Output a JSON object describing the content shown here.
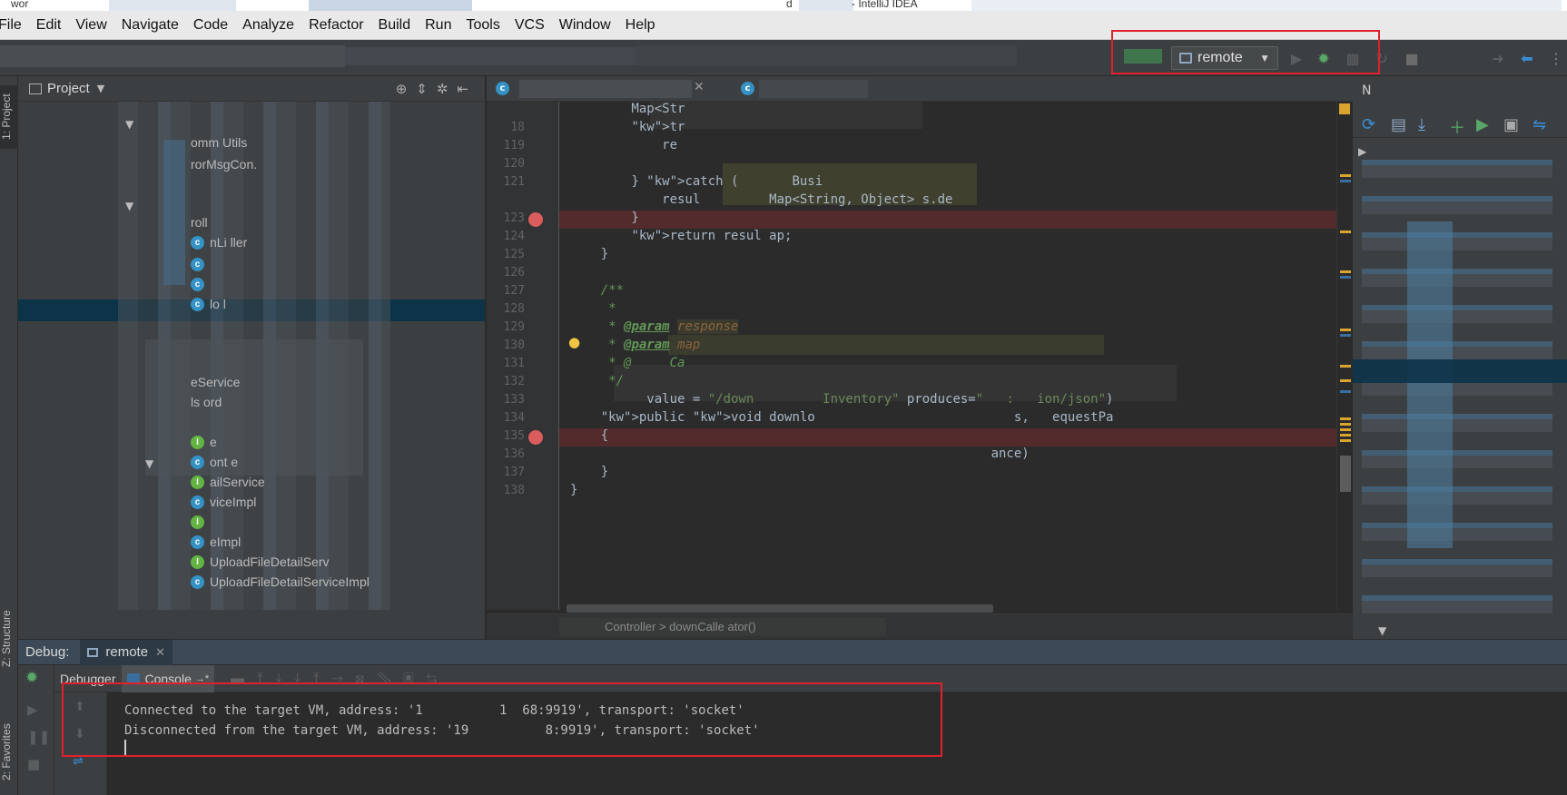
{
  "window": {
    "title_left": "wor",
    "title_right": "- IntelliJ IDEA"
  },
  "menu": [
    "File",
    "Edit",
    "View",
    "Navigate",
    "Code",
    "Analyze",
    "Refactor",
    "Build",
    "Run",
    "Tools",
    "VCS",
    "Window",
    "Help"
  ],
  "toolbar": {
    "run_config": "remote"
  },
  "left_strip": {
    "project_tab": "1: Project",
    "structure_tab": "Z: Structure",
    "favorites_tab": "2: Favorites"
  },
  "project": {
    "title": "Project",
    "rows": [
      {
        "text": "omm   Utils",
        "icon": ""
      },
      {
        "text": "rorMsgCon.",
        "icon": ""
      },
      {
        "text": "roll",
        "icon": ""
      },
      {
        "text": "     nLi    ller",
        "icon": "c"
      },
      {
        "text": "",
        "icon": "c"
      },
      {
        "text": "",
        "icon": "c"
      },
      {
        "text": "lo     l",
        "icon": "c"
      },
      {
        "text": "           eService",
        "icon": ""
      },
      {
        "text": "ls         ord",
        "icon": ""
      },
      {
        "text": "           e",
        "icon": "i"
      },
      {
        "text": "        ont  e",
        "icon": "c"
      },
      {
        "text": "             ailService",
        "icon": "i"
      },
      {
        "text": "             viceImpl",
        "icon": "c"
      },
      {
        "text": "",
        "icon": "i"
      },
      {
        "text": "             eImpl",
        "icon": "c"
      },
      {
        "text": "UploadFileDetailServ",
        "icon": "i"
      },
      {
        "text": "UploadFileDetailServiceImpl",
        "icon": "c"
      }
    ]
  },
  "editor": {
    "lines": [
      {
        "num": "",
        "text": "        Map<Str"
      },
      {
        "num": "18",
        "text": "        tr"
      },
      {
        "num": "119",
        "text": "            re"
      },
      {
        "num": "120",
        "text": ""
      },
      {
        "num": "121",
        "text": "        } catch (       Busi"
      },
      {
        "num": "",
        "text": "            resul         Map<String, Object> s.de"
      },
      {
        "num": "123",
        "text": "        }"
      },
      {
        "num": "124",
        "text": "        return resul ap;"
      },
      {
        "num": "125",
        "text": "    }"
      },
      {
        "num": "126",
        "text": ""
      },
      {
        "num": "127",
        "text": "    /**"
      },
      {
        "num": "128",
        "text": "     *"
      },
      {
        "num": "129",
        "text": "     * @param response"
      },
      {
        "num": "130",
        "text": "     * @param map"
      },
      {
        "num": "131",
        "text": "     * @     Ca"
      },
      {
        "num": "132",
        "text": "     */"
      },
      {
        "num": "133",
        "text": "          value = \"/down         Inventory\" produces=\"   :   ion/json\")"
      },
      {
        "num": "134",
        "text": "    public void downlo                          s,   equestPa"
      },
      {
        "num": "135",
        "text": "    {"
      },
      {
        "num": "136",
        "text": "                                                       ance)"
      },
      {
        "num": "137",
        "text": "    }"
      },
      {
        "num": "138",
        "text": "}"
      }
    ],
    "breadcrumb": "Controller > downCalle          ator()"
  },
  "debug": {
    "label": "Debug:",
    "tab": "remote",
    "subtabs": {
      "debugger": "Debugger",
      "console": "Console"
    },
    "console_lines": [
      "Connected to the target VM, address: '1          1  68:9919', transport: 'socket'",
      "Disconnected from the target VM, address: '19          8:9919', transport: 'socket'"
    ]
  }
}
